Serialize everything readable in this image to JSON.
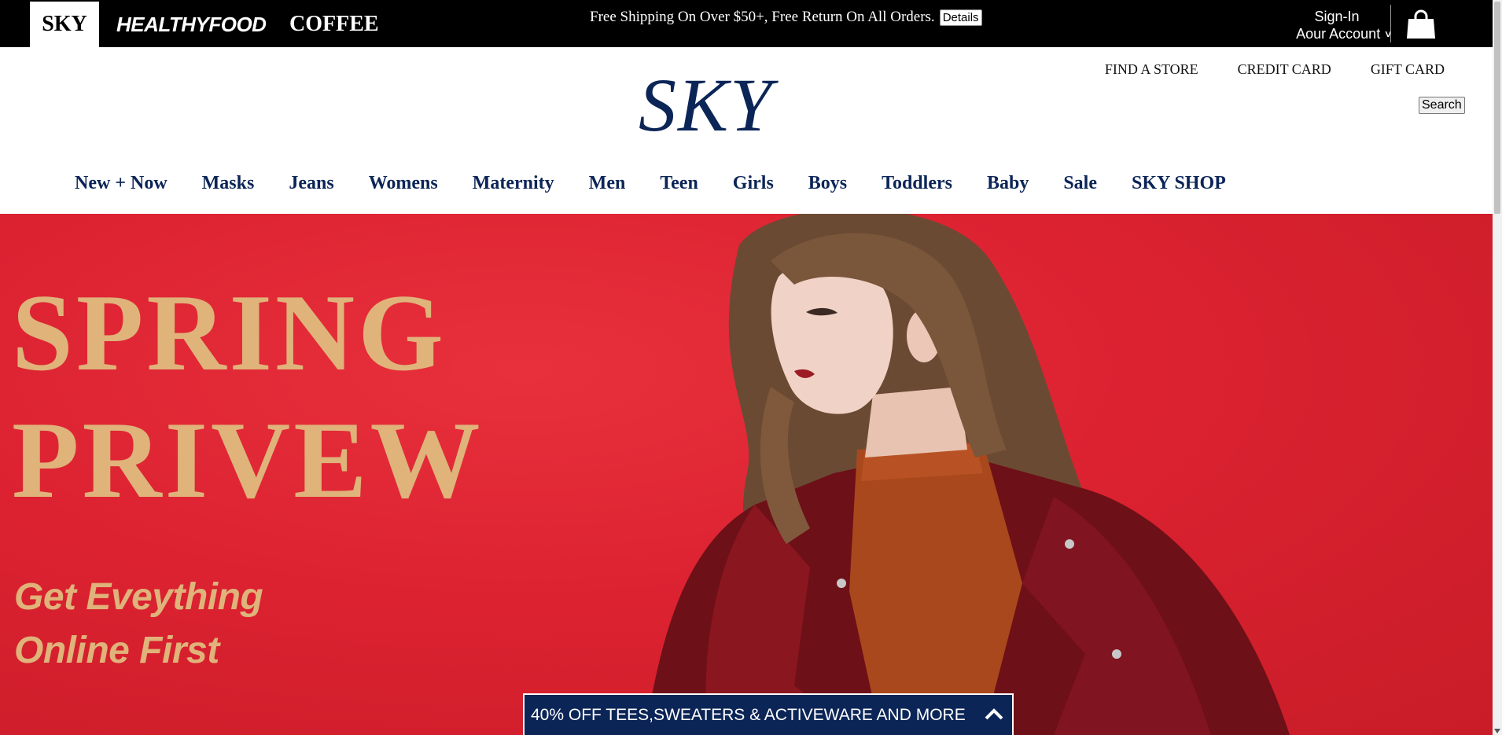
{
  "topbar": {
    "brands": [
      "SKY",
      "HEALTHYFOOD",
      "COFFEE"
    ],
    "promo_text": "Free Shipping On Over $50+, Free Return On All Orders.",
    "details_label": "Details",
    "signin_label": "Sign-In",
    "account_label": "Aour Account",
    "cart_icon": "shopping-bag-icon"
  },
  "header": {
    "logo": "SKY",
    "links": [
      "FIND A STORE",
      "CREDIT CARD",
      "GIFT CARD"
    ],
    "search_label": "Search"
  },
  "nav": {
    "items": [
      "New + Now",
      "Masks",
      "Jeans",
      "Womens",
      "Maternity",
      "Men",
      "Teen",
      "Girls",
      "Boys",
      "Toddlers",
      "Baby",
      "Sale",
      "SKY SHOP"
    ]
  },
  "hero": {
    "title_line1": "SPRING",
    "title_line2": "PRIVEW",
    "subtitle_line1": "Get Eveything",
    "subtitle_line2": "Online First"
  },
  "banner": {
    "text": "40% OFF TEES,SWEATERS & ACTIVEWARE AND MORE"
  },
  "colors": {
    "navy": "#0c2557",
    "hero_red": "#dc2231",
    "gold": "#dfb37a",
    "topbar": "#000000"
  }
}
